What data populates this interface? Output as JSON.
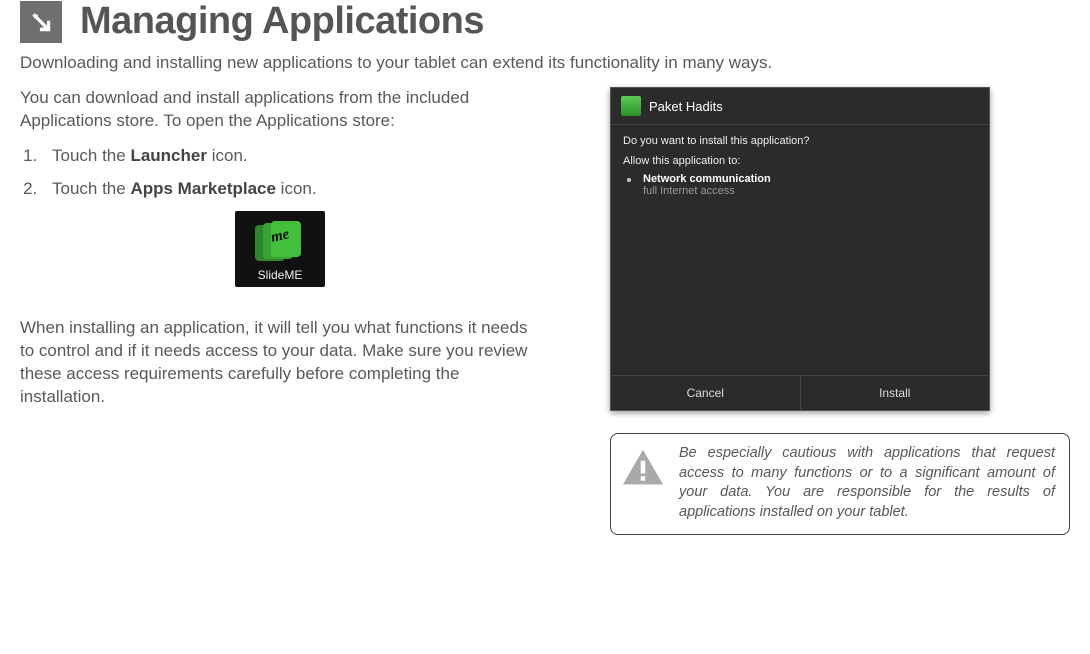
{
  "header": {
    "title": "Managing Applications"
  },
  "intro": "Downloading and installing new applications to your tablet can extend its functionality in many ways.",
  "left": {
    "para1": "You can download and install applications from the included Applications store. To open the Applications store:",
    "steps": {
      "s1_pre": "Touch the ",
      "s1_bold": "Launcher",
      "s1_post": " icon.",
      "s2_pre": "Touch the ",
      "s2_bold": "Apps Marketplace",
      "s2_post": " icon."
    },
    "para2": "When installing an application, it will tell you what functions it needs to control and if it needs access to your data. Make sure you review these access requirements carefully before completing the installation."
  },
  "slideme": {
    "script": "me",
    "label": "SlideME"
  },
  "dialog": {
    "title": "Paket Hadits",
    "question": "Do you want to install this application?",
    "allow": "Allow this application to:",
    "perm_title": "Network communication",
    "perm_sub": "full Internet access",
    "cancel": "Cancel",
    "install": "Install"
  },
  "warning": {
    "text": "Be especially cautious with applications that request access to many functions or to a significant amount of your data. You are responsible for the results of applications installed on your tablet."
  }
}
